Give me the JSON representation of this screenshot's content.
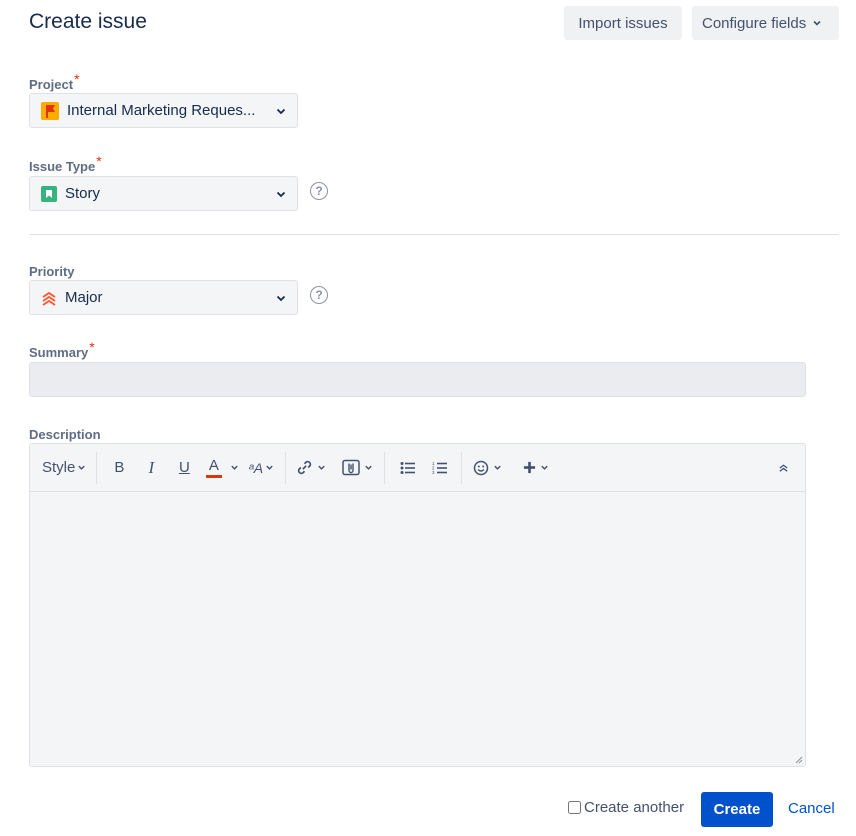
{
  "header": {
    "title": "Create issue",
    "import_label": "Import issues",
    "configure_label": "Configure fields"
  },
  "project": {
    "label": "Project",
    "required_mark": "*",
    "value": "Internal Marketing Reques...",
    "icon": "project-flag-icon"
  },
  "issue_type": {
    "label": "Issue Type",
    "required_mark": "*",
    "value": "Story",
    "icon": "story-icon"
  },
  "priority": {
    "label": "Priority",
    "value": "Major",
    "icon": "priority-major-icon"
  },
  "summary": {
    "label": "Summary",
    "required_mark": "*",
    "value": ""
  },
  "description": {
    "label": "Description",
    "toolbar": {
      "style_label": "Style",
      "bold": "B",
      "italic": "I",
      "underline": "U",
      "text_color": "A",
      "text_effects": "ᵃA"
    }
  },
  "footer": {
    "create_another_label": "Create another",
    "create_another_checked": false,
    "create_label": "Create",
    "cancel_label": "Cancel"
  },
  "colors": {
    "primary": "#0052cc",
    "required": "#de350b",
    "priority": "#ff5630",
    "story": "#36b37e",
    "text_color_bar": "#de350b"
  }
}
